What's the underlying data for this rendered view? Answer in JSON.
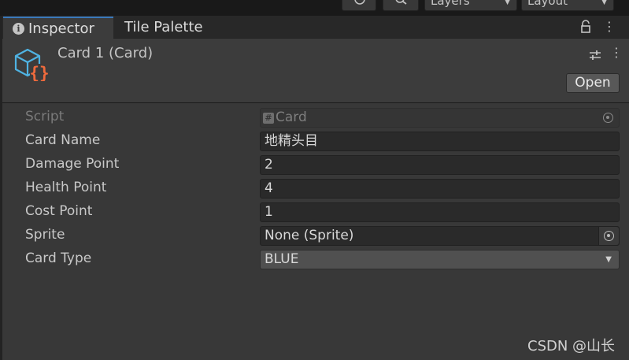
{
  "toolbar": {
    "history_icon": "history-icon",
    "search_icon": "search-icon",
    "layers_label": "Layers",
    "layout_label": "Layout"
  },
  "tabs": [
    {
      "label": "Inspector",
      "icon": "info-icon",
      "active": true
    },
    {
      "label": "Tile Palette",
      "active": false
    }
  ],
  "header": {
    "icon": "script-component-icon",
    "title": "Card 1 (Card)",
    "open_label": "Open"
  },
  "properties": [
    {
      "label": "Script",
      "value": "Card",
      "kind": "object-readonly"
    },
    {
      "label": "Card Name",
      "value": "地精头目",
      "kind": "text"
    },
    {
      "label": "Damage Point",
      "value": "2",
      "kind": "int"
    },
    {
      "label": "Health Point",
      "value": "4",
      "kind": "int"
    },
    {
      "label": "Cost Point",
      "value": "1",
      "kind": "int"
    },
    {
      "label": "Sprite",
      "value": "None (Sprite)",
      "kind": "object"
    },
    {
      "label": "Card Type",
      "value": "BLUE",
      "kind": "enum"
    }
  ],
  "colors": {
    "accent_tab": "#3a79bb",
    "icon_cube": "#4fb3e3",
    "icon_braces": "#ef6a3c"
  },
  "watermark": "CSDN @山长"
}
